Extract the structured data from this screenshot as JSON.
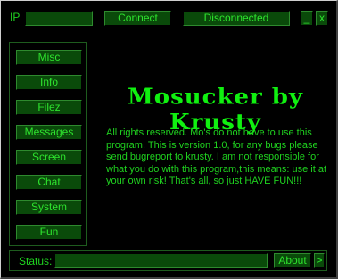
{
  "top": {
    "ip_label": "IP",
    "connect_label": "Connect",
    "connection_status": "Disconnected",
    "minimize_label": "_",
    "close_label": "x"
  },
  "nav": {
    "items": [
      "Misc",
      "Info",
      "Filez",
      "Messages",
      "Screen",
      "Chat",
      "System",
      "Fun"
    ]
  },
  "content": {
    "title": "Mosucker by Krusty",
    "description": "All rights reserved. Mo's do not have to use this program. This is version 1.0, for any bugs please send bugreport to krusty. I am not responsible for what you do with this program,this means: use it at your own risk! That's all, so just HAVE FUN!!!"
  },
  "bottom": {
    "status_label": "Status:",
    "status_value": "",
    "about_label": "About",
    "next_label": ">"
  },
  "colors": {
    "background": "#000000",
    "accent_green": "#1fd21f",
    "button_fill": "#0a4a0a"
  }
}
